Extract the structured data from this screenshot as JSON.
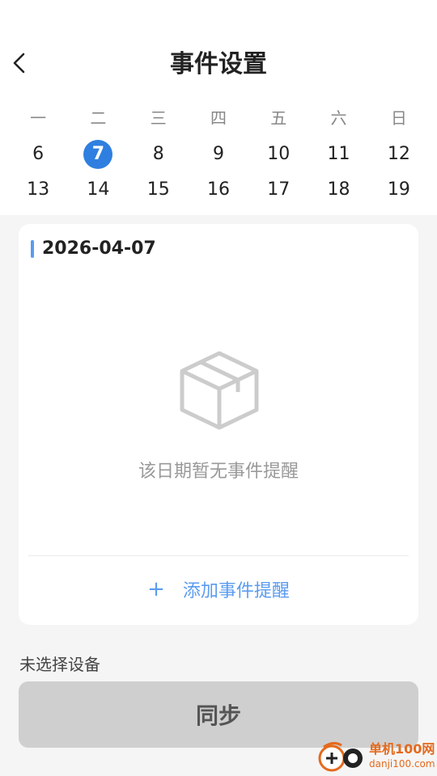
{
  "header": {
    "title": "事件设置",
    "back_icon": "chevron-left-icon"
  },
  "calendar": {
    "weekdays": [
      "一",
      "二",
      "三",
      "四",
      "五",
      "六",
      "日"
    ],
    "row1": [
      "6",
      "7",
      "8",
      "9",
      "10",
      "11",
      "12"
    ],
    "row2": [
      "13",
      "14",
      "15",
      "16",
      "17",
      "18",
      "19"
    ],
    "selected": "7",
    "selected_color": "#2f7fe0"
  },
  "events": {
    "date": "2026-04-07",
    "empty_text": "该日期暂无事件提醒",
    "empty_icon": "box-icon",
    "add_plus": "+",
    "add_label": "添加事件提醒",
    "accent_color": "#5b9cf0"
  },
  "device": {
    "status": "未选择设备",
    "sync_label": "同步"
  },
  "watermark": {
    "cn": "单机100网",
    "en": "danji100.com"
  }
}
